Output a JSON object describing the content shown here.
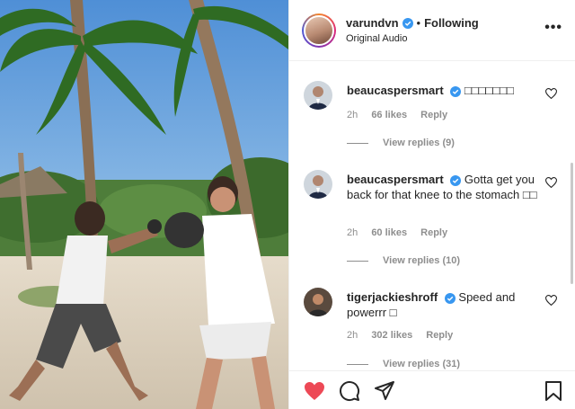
{
  "header": {
    "username": "varundvn",
    "separator": "•",
    "follow_status": "Following",
    "audio": "Original Audio",
    "more": "•••"
  },
  "comments": [
    {
      "username": "beaucaspersmart",
      "text": "□□□□□□□",
      "time": "2h",
      "likes": "66 likes",
      "reply": "Reply",
      "view_replies": "View replies (9)"
    },
    {
      "username": "beaucaspersmart",
      "text": "Gotta get you back for that knee to the stomach □□",
      "time": "2h",
      "likes": "60 likes",
      "reply": "Reply",
      "view_replies": "View replies (10)"
    },
    {
      "username": "tigerjackieshroff",
      "text": "Speed and powerrr □",
      "time": "2h",
      "likes": "302 likes",
      "reply": "Reply",
      "view_replies": "View replies (31)"
    }
  ],
  "actions": [
    "heart-filled-icon",
    "comment-icon",
    "share-icon",
    "bookmark-icon"
  ],
  "colors": {
    "like_red": "#ed4956",
    "verified_blue": "#3897f0",
    "muted": "#8e8e8e",
    "text": "#262626"
  }
}
